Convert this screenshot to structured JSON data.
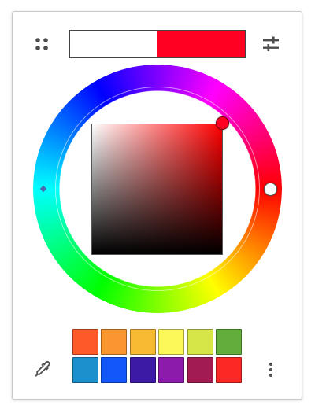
{
  "colors": {
    "previous": "#ffffff",
    "current": "#ff0022",
    "hue_base": "#ff0000",
    "icon": "#4d4d4d"
  },
  "icons": {
    "palette_toggle": "four-dots-icon",
    "sliders_toggle": "sliders-icon",
    "eyedropper": "eyedropper-icon",
    "more": "vertical-dots-icon"
  },
  "swatches": [
    [
      "#fc5a28",
      "#fa9630",
      "#f8ba32",
      "#fcf85a",
      "#d6e646",
      "#62ad3c"
    ],
    [
      "#1c90cc",
      "#1356fa",
      "#3c1aa6",
      "#8c1aaa",
      "#a21c52",
      "#fc2826"
    ]
  ]
}
